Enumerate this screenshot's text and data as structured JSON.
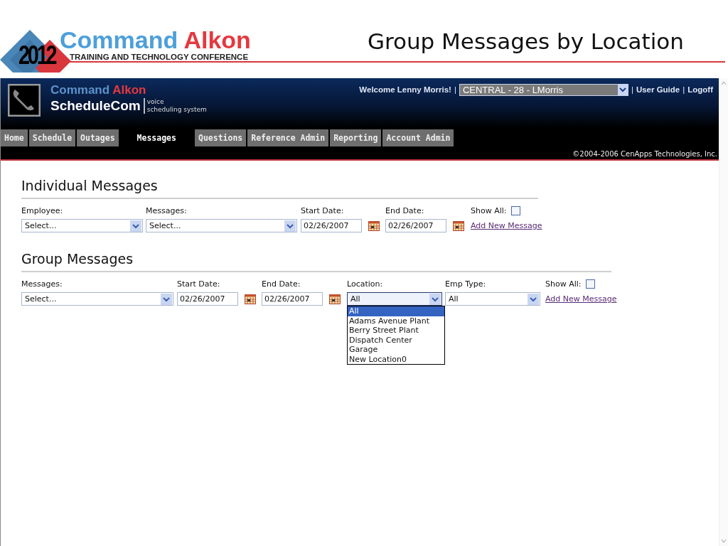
{
  "slide": {
    "logo": {
      "year": "2012",
      "brand_first": "Command",
      "brand_second": "Alkon",
      "tagline": "TRAINING AND TECHNOLOGY CONFERENCE"
    },
    "title": "Group Messages by Location"
  },
  "app": {
    "brand_first": "Command",
    "brand_second": "Alkon",
    "product": "ScheduleCom",
    "tagline": [
      "voice",
      "scheduling system"
    ],
    "user_bar": [
      {
        "kind": "text",
        "text": "Welcome Lenny Morris!"
      },
      {
        "kind": "sep",
        "text": "|"
      },
      {
        "kind": "select",
        "value": "CENTRAL - 28 - LMorris"
      },
      {
        "kind": "sep",
        "text": "|"
      },
      {
        "kind": "link",
        "text": "User Guide"
      },
      {
        "kind": "sep",
        "text": "|"
      },
      {
        "kind": "link",
        "text": "Logoff"
      }
    ],
    "tabs": [
      {
        "label": "Home",
        "selected": false
      },
      {
        "label": "Schedule",
        "selected": false
      },
      {
        "label": "Outages",
        "selected": false
      },
      {
        "label": "Messages",
        "selected": true
      },
      {
        "label": "Questions",
        "selected": false
      },
      {
        "label": "Reference Admin",
        "selected": false
      },
      {
        "label": "Reporting",
        "selected": false
      },
      {
        "label": "Account Admin",
        "selected": false
      }
    ],
    "copyright": "©2004-2006 CenApps Technologies, Inc."
  },
  "sections": [
    {
      "title": "Individual Messages",
      "fields": [
        {
          "kind": "select",
          "label": "Employee:",
          "value": "Select...",
          "expanded": false
        },
        {
          "kind": "select",
          "label": "Messages:",
          "value": "Select...",
          "expanded": false
        },
        {
          "kind": "date",
          "label": "Start Date:",
          "value": "02/26/2007"
        },
        {
          "kind": "date",
          "label": "End Date:",
          "value": "02/26/2007"
        },
        {
          "kind": "checkbox",
          "label": "Show All:",
          "checked": false,
          "link": "Add New Message"
        }
      ]
    },
    {
      "title": "Group Messages",
      "fields": [
        {
          "kind": "select",
          "label": "Messages:",
          "value": "Select...",
          "expanded": false
        },
        {
          "kind": "date",
          "label": "Start Date:",
          "value": "02/26/2007"
        },
        {
          "kind": "date",
          "label": "End Date:",
          "value": "02/26/2007"
        },
        {
          "kind": "select",
          "label": "Location:",
          "value": "All",
          "expanded": true,
          "options": [
            {
              "text": "All",
              "selected": true
            },
            {
              "text": "Adams Avenue Plant",
              "selected": false
            },
            {
              "text": "Berry Street Plant",
              "selected": false
            },
            {
              "text": "Dispatch Center",
              "selected": false
            },
            {
              "text": "Garage",
              "selected": false
            },
            {
              "text": "New Location0",
              "selected": false
            }
          ]
        },
        {
          "kind": "select",
          "label": "Emp Type:",
          "value": "All",
          "expanded": false
        },
        {
          "kind": "checkbox",
          "label": "Show All:",
          "checked": false,
          "link": "Add New Message"
        }
      ]
    }
  ]
}
